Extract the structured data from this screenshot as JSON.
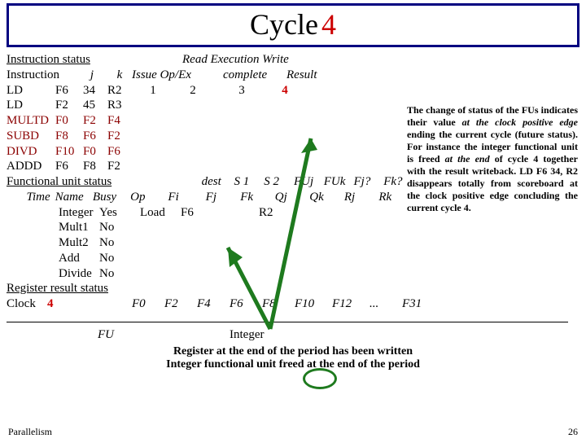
{
  "title": {
    "word": "Cycle",
    "num": "4"
  },
  "note": {
    "t1": "The change of status of the FUs indicates their value ",
    "em1": "at the clock positive edge",
    "t2": " ending  the current cycle (future status). For instance the integer functional unit is freed ",
    "em2": "at the end",
    "t3": " of cycle 4 together with the result writeback. LD F6 34, R2 disappears totally from scoreboard at  the  clock  positive  edge concluding the current cycle 4."
  },
  "hdr": {
    "a": "Instruction status",
    "b": "Read Execution Write",
    "c1": "Instruction",
    "c2": "j",
    "c3": "k",
    "c4": "Issue Op/Ex",
    "c5": "complete",
    "c6": "Result"
  },
  "instr": [
    {
      "op": "LD",
      "d": "F6",
      "j": "34",
      "k": "R2",
      "issue": "1",
      "read": "2",
      "exec": "3",
      "write": "4"
    },
    {
      "op": "LD",
      "d": "F2",
      "j": "45",
      "k": "R3",
      "issue": "",
      "read": "",
      "exec": "",
      "write": ""
    },
    {
      "op": "MULTD",
      "d": "F0",
      "j": "F2",
      "k": "F4",
      "issue": "",
      "read": "",
      "exec": "",
      "write": ""
    },
    {
      "op": "SUBD",
      "d": "F8",
      "j": "F6",
      "k": "F2",
      "issue": "",
      "read": "",
      "exec": "",
      "write": ""
    },
    {
      "op": "DIVD",
      "d": "F10",
      "j": "F0",
      "k": "F6",
      "issue": "",
      "read": "",
      "exec": "",
      "write": ""
    },
    {
      "op": "ADDD",
      "d": "F6",
      "j": "F8",
      "k": "F2",
      "issue": "",
      "read": "",
      "exec": "",
      "write": ""
    }
  ],
  "fu": {
    "title": "Functional unit status",
    "cols": {
      "time": "Time",
      "name": "Name",
      "busy": "Busy",
      "op": "Op",
      "dest": "dest",
      "fi": "Fi",
      "s1": "S 1",
      "fj": "Fj",
      "s2": "S 2",
      "fk": "Fk",
      "fuj": "FUj",
      "qj": "Qj",
      "fuk": "FUk",
      "qk": "Qk",
      "rjq": "Fj?",
      "rj": "Rj",
      "rkq": "Fk?",
      "rk": "Rk"
    },
    "rows": [
      {
        "name": "Integer",
        "busy": "Yes",
        "op": "Load",
        "fi": "F6",
        "fk": "R2"
      },
      {
        "name": "Mult1",
        "busy": "No"
      },
      {
        "name": "Mult2",
        "busy": "No"
      },
      {
        "name": "Add",
        "busy": "No"
      },
      {
        "name": "Divide",
        "busy": "No"
      }
    ]
  },
  "reg": {
    "title": "Register result status",
    "clock_lbl": "Clock",
    "clock_val": "4",
    "fu_lbl": "FU",
    "cols": [
      "F0",
      "F2",
      "F4",
      "F6",
      "F8",
      "F10",
      "F12",
      "...",
      "F31"
    ],
    "vals": [
      "",
      "",
      "",
      "Integer",
      "",
      "",
      "",
      "",
      ""
    ]
  },
  "caption": {
    "l1": "Register at the end of the period has been written",
    "l2": "Integer functional unit freed at the end of the period"
  },
  "footer": {
    "left": "Parallelism",
    "right": "26"
  }
}
